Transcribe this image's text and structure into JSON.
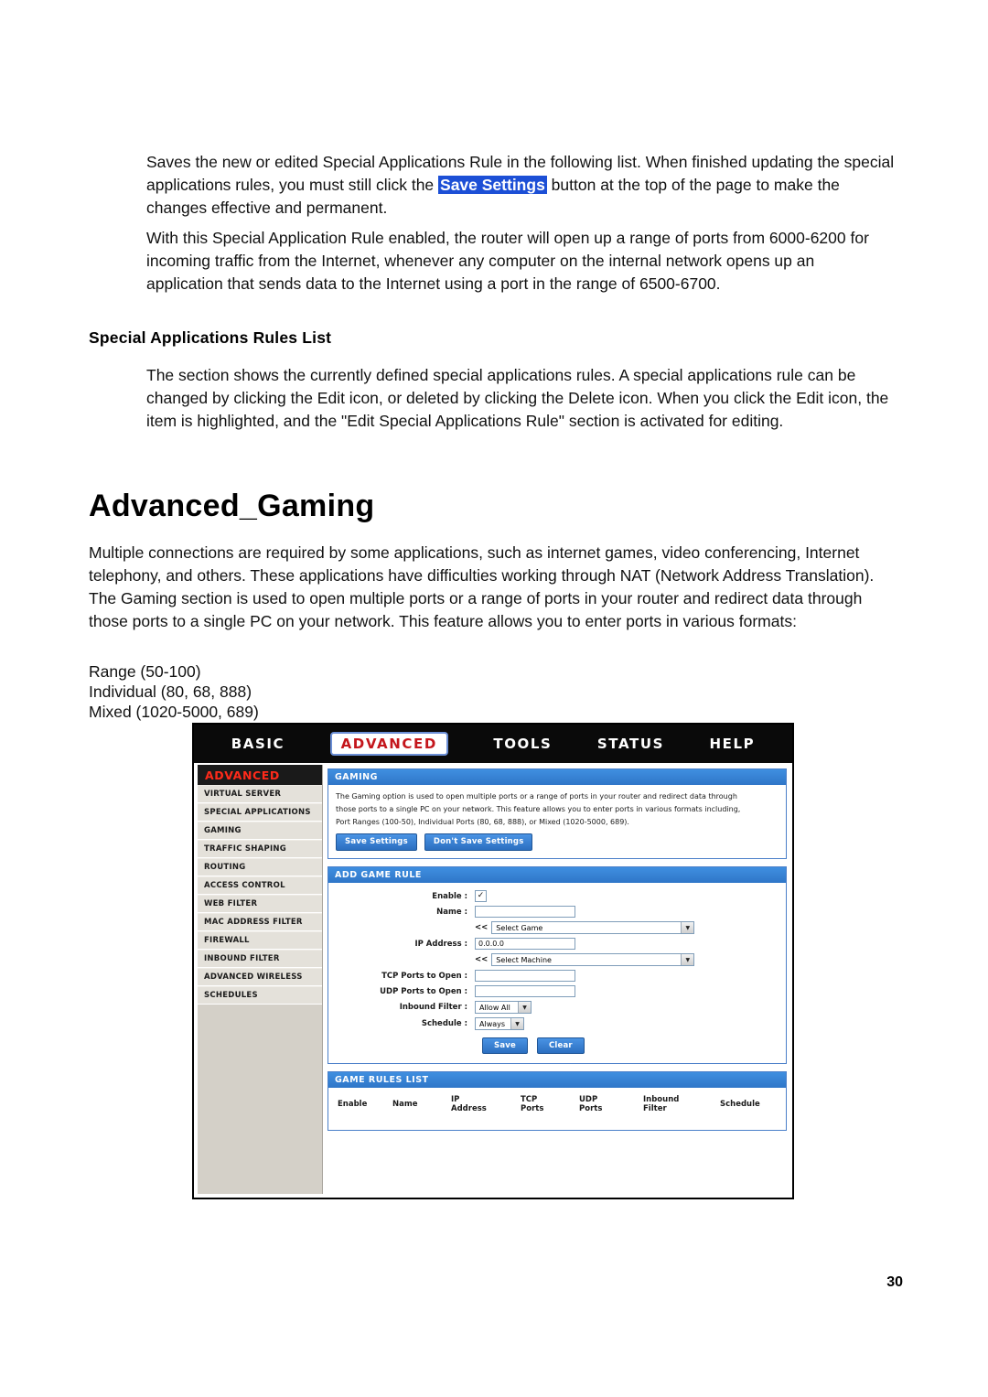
{
  "document": {
    "paragraphs": [
      "Saves the new or edited Special Applications Rule in the following list. When finished updating the special applications rules, you must still click the ",
      " button at the top of the page to make the changes effective and permanent.",
      "With this Special Application Rule enabled, the router will open up a range of ports from 6000-6200 for incoming traffic from the Internet, whenever any computer on the internal network opens up an application that sends data to the Internet using a port in the range of 6500-6700.",
      "The section shows the currently defined special applications rules. A special applications rule can be changed by clicking the Edit icon, or deleted by clicking the Delete icon. When you click the Edit icon, the item is highlighted, and the \"Edit Special Applications Rule\" section is activated for editing.",
      "Multiple connections are required by some applications, such as internet games, video conferencing, Internet telephony, and others. These applications have difficulties working through NAT (Network Address Translation). The Gaming section is used to open multiple ports or a range of ports in your router and redirect data through those ports to a single PC on your network. This feature allows you to enter ports in various formats:"
    ],
    "highlight_label": "Save Settings",
    "subheading": "Special Applications Rules List",
    "title": "Advanced_Gaming",
    "formats": [
      "Range (50-100)",
      "Individual (80, 68, 888)",
      "Mixed (1020-5000, 689)"
    ],
    "page_number": "30"
  },
  "screenshot": {
    "topnav": [
      {
        "label": "BASIC",
        "active": false
      },
      {
        "label": "ADVANCED",
        "active": true
      },
      {
        "label": "TOOLS",
        "active": false
      },
      {
        "label": "STATUS",
        "active": false
      },
      {
        "label": "HELP",
        "active": false
      }
    ],
    "sidebar": {
      "header": "ADVANCED",
      "items": [
        "VIRTUAL SERVER",
        "SPECIAL APPLICATIONS",
        "GAMING",
        "TRAFFIC SHAPING",
        "ROUTING",
        "ACCESS CONTROL",
        "WEB FILTER",
        "MAC ADDRESS FILTER",
        "FIREWALL",
        "INBOUND FILTER",
        "ADVANCED WIRELESS",
        "SCHEDULES"
      ]
    },
    "gaming_panel": {
      "title": "GAMING",
      "description_line1": "The Gaming option is used to open multiple ports or a range of ports in your router and redirect data through",
      "description_line2": "those ports to a single PC on your network. This feature allows you to enter ports in various formats including,",
      "description_line3": "Port Ranges (100-50), Individual Ports (80, 68, 888), or Mixed (1020-5000, 689).",
      "save_button": "Save Settings",
      "dont_save_button": "Don't Save Settings"
    },
    "add_game_rule": {
      "title": "ADD GAME RULE",
      "enable_label": "Enable :",
      "enable_checked": "✓",
      "name_label": "Name :",
      "name_value": "",
      "name_select_prefix": "<<",
      "name_select_value": "Select Game",
      "ip_label": "IP Address :",
      "ip_value": "0.0.0.0",
      "ip_select_prefix": "<<",
      "ip_select_value": "Select Machine",
      "tcp_label": "TCP Ports to Open :",
      "tcp_value": "",
      "udp_label": "UDP Ports to Open :",
      "udp_value": "",
      "inbound_label": "Inbound Filter :",
      "inbound_value": "Allow All",
      "schedule_label": "Schedule :",
      "schedule_value": "Always",
      "save_button": "Save",
      "clear_button": "Clear"
    },
    "game_rules_list": {
      "title": "GAME RULES LIST",
      "columns": [
        "Enable",
        "Name",
        "IP\nAddress",
        "TCP\nPorts",
        "UDP\nPorts",
        "Inbound\nFilter",
        "Schedule"
      ],
      "columns_flat": [
        "Enable",
        "Name",
        "IP Address",
        "TCP Ports",
        "UDP Ports",
        "Inbound Filter",
        "Schedule"
      ],
      "rows": []
    }
  }
}
